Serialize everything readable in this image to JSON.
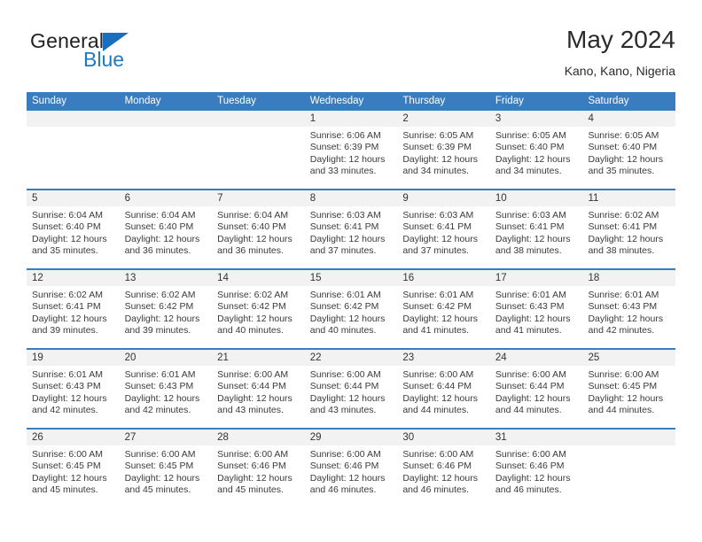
{
  "brand": {
    "name_top": "General",
    "name_bottom": "Blue",
    "triangle_icon": "triangle-icon",
    "accent_color": "#1a7bc7"
  },
  "header": {
    "title": "May 2024",
    "subtitle": "Kano, Kano, Nigeria"
  },
  "calendar": {
    "header_bg": "#3a7cc0",
    "weekdays": [
      "Sunday",
      "Monday",
      "Tuesday",
      "Wednesday",
      "Thursday",
      "Friday",
      "Saturday"
    ],
    "weeks": [
      [
        {
          "day": "",
          "lines": []
        },
        {
          "day": "",
          "lines": []
        },
        {
          "day": "",
          "lines": []
        },
        {
          "day": "1",
          "lines": [
            "Sunrise: 6:06 AM",
            "Sunset: 6:39 PM",
            "Daylight: 12 hours",
            "and 33 minutes."
          ]
        },
        {
          "day": "2",
          "lines": [
            "Sunrise: 6:05 AM",
            "Sunset: 6:39 PM",
            "Daylight: 12 hours",
            "and 34 minutes."
          ]
        },
        {
          "day": "3",
          "lines": [
            "Sunrise: 6:05 AM",
            "Sunset: 6:40 PM",
            "Daylight: 12 hours",
            "and 34 minutes."
          ]
        },
        {
          "day": "4",
          "lines": [
            "Sunrise: 6:05 AM",
            "Sunset: 6:40 PM",
            "Daylight: 12 hours",
            "and 35 minutes."
          ]
        }
      ],
      [
        {
          "day": "5",
          "lines": [
            "Sunrise: 6:04 AM",
            "Sunset: 6:40 PM",
            "Daylight: 12 hours",
            "and 35 minutes."
          ]
        },
        {
          "day": "6",
          "lines": [
            "Sunrise: 6:04 AM",
            "Sunset: 6:40 PM",
            "Daylight: 12 hours",
            "and 36 minutes."
          ]
        },
        {
          "day": "7",
          "lines": [
            "Sunrise: 6:04 AM",
            "Sunset: 6:40 PM",
            "Daylight: 12 hours",
            "and 36 minutes."
          ]
        },
        {
          "day": "8",
          "lines": [
            "Sunrise: 6:03 AM",
            "Sunset: 6:41 PM",
            "Daylight: 12 hours",
            "and 37 minutes."
          ]
        },
        {
          "day": "9",
          "lines": [
            "Sunrise: 6:03 AM",
            "Sunset: 6:41 PM",
            "Daylight: 12 hours",
            "and 37 minutes."
          ]
        },
        {
          "day": "10",
          "lines": [
            "Sunrise: 6:03 AM",
            "Sunset: 6:41 PM",
            "Daylight: 12 hours",
            "and 38 minutes."
          ]
        },
        {
          "day": "11",
          "lines": [
            "Sunrise: 6:02 AM",
            "Sunset: 6:41 PM",
            "Daylight: 12 hours",
            "and 38 minutes."
          ]
        }
      ],
      [
        {
          "day": "12",
          "lines": [
            "Sunrise: 6:02 AM",
            "Sunset: 6:41 PM",
            "Daylight: 12 hours",
            "and 39 minutes."
          ]
        },
        {
          "day": "13",
          "lines": [
            "Sunrise: 6:02 AM",
            "Sunset: 6:42 PM",
            "Daylight: 12 hours",
            "and 39 minutes."
          ]
        },
        {
          "day": "14",
          "lines": [
            "Sunrise: 6:02 AM",
            "Sunset: 6:42 PM",
            "Daylight: 12 hours",
            "and 40 minutes."
          ]
        },
        {
          "day": "15",
          "lines": [
            "Sunrise: 6:01 AM",
            "Sunset: 6:42 PM",
            "Daylight: 12 hours",
            "and 40 minutes."
          ]
        },
        {
          "day": "16",
          "lines": [
            "Sunrise: 6:01 AM",
            "Sunset: 6:42 PM",
            "Daylight: 12 hours",
            "and 41 minutes."
          ]
        },
        {
          "day": "17",
          "lines": [
            "Sunrise: 6:01 AM",
            "Sunset: 6:43 PM",
            "Daylight: 12 hours",
            "and 41 minutes."
          ]
        },
        {
          "day": "18",
          "lines": [
            "Sunrise: 6:01 AM",
            "Sunset: 6:43 PM",
            "Daylight: 12 hours",
            "and 42 minutes."
          ]
        }
      ],
      [
        {
          "day": "19",
          "lines": [
            "Sunrise: 6:01 AM",
            "Sunset: 6:43 PM",
            "Daylight: 12 hours",
            "and 42 minutes."
          ]
        },
        {
          "day": "20",
          "lines": [
            "Sunrise: 6:01 AM",
            "Sunset: 6:43 PM",
            "Daylight: 12 hours",
            "and 42 minutes."
          ]
        },
        {
          "day": "21",
          "lines": [
            "Sunrise: 6:00 AM",
            "Sunset: 6:44 PM",
            "Daylight: 12 hours",
            "and 43 minutes."
          ]
        },
        {
          "day": "22",
          "lines": [
            "Sunrise: 6:00 AM",
            "Sunset: 6:44 PM",
            "Daylight: 12 hours",
            "and 43 minutes."
          ]
        },
        {
          "day": "23",
          "lines": [
            "Sunrise: 6:00 AM",
            "Sunset: 6:44 PM",
            "Daylight: 12 hours",
            "and 44 minutes."
          ]
        },
        {
          "day": "24",
          "lines": [
            "Sunrise: 6:00 AM",
            "Sunset: 6:44 PM",
            "Daylight: 12 hours",
            "and 44 minutes."
          ]
        },
        {
          "day": "25",
          "lines": [
            "Sunrise: 6:00 AM",
            "Sunset: 6:45 PM",
            "Daylight: 12 hours",
            "and 44 minutes."
          ]
        }
      ],
      [
        {
          "day": "26",
          "lines": [
            "Sunrise: 6:00 AM",
            "Sunset: 6:45 PM",
            "Daylight: 12 hours",
            "and 45 minutes."
          ]
        },
        {
          "day": "27",
          "lines": [
            "Sunrise: 6:00 AM",
            "Sunset: 6:45 PM",
            "Daylight: 12 hours",
            "and 45 minutes."
          ]
        },
        {
          "day": "28",
          "lines": [
            "Sunrise: 6:00 AM",
            "Sunset: 6:46 PM",
            "Daylight: 12 hours",
            "and 45 minutes."
          ]
        },
        {
          "day": "29",
          "lines": [
            "Sunrise: 6:00 AM",
            "Sunset: 6:46 PM",
            "Daylight: 12 hours",
            "and 46 minutes."
          ]
        },
        {
          "day": "30",
          "lines": [
            "Sunrise: 6:00 AM",
            "Sunset: 6:46 PM",
            "Daylight: 12 hours",
            "and 46 minutes."
          ]
        },
        {
          "day": "31",
          "lines": [
            "Sunrise: 6:00 AM",
            "Sunset: 6:46 PM",
            "Daylight: 12 hours",
            "and 46 minutes."
          ]
        },
        {
          "day": "",
          "lines": []
        }
      ]
    ]
  }
}
